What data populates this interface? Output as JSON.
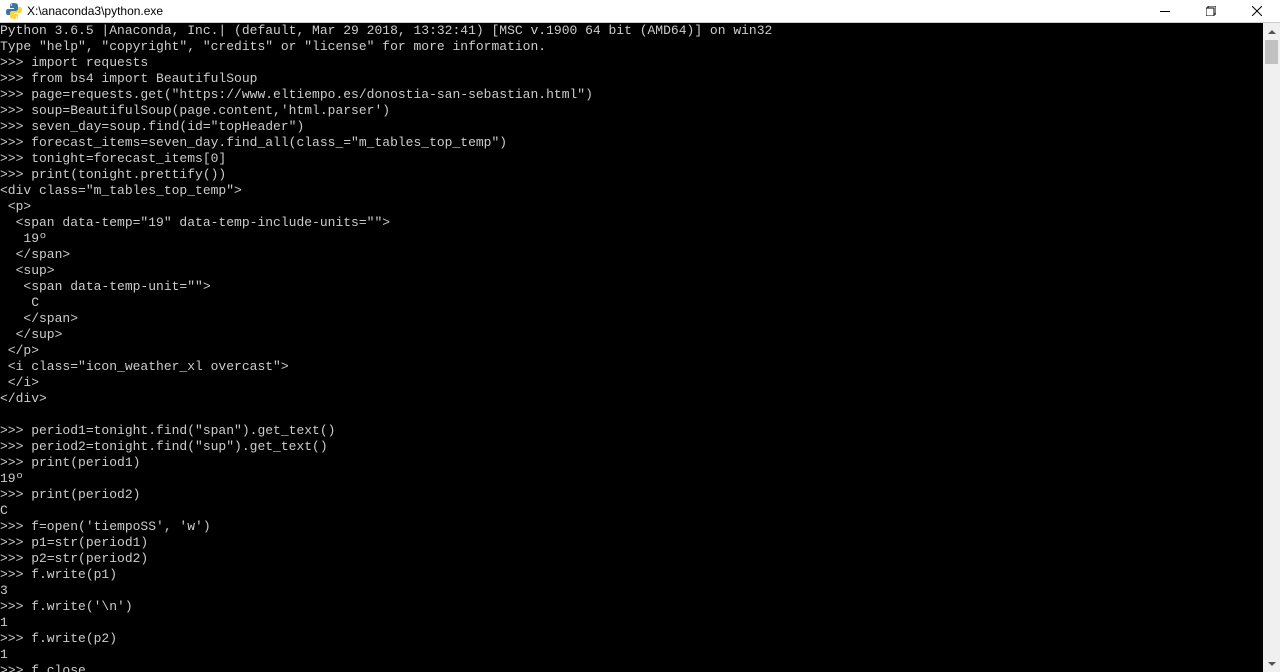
{
  "window": {
    "title": "X:\\anaconda3\\python.exe"
  },
  "terminal": {
    "lines": [
      "Python 3.6.5 |Anaconda, Inc.| (default, Mar 29 2018, 13:32:41) [MSC v.1900 64 bit (AMD64)] on win32",
      "Type \"help\", \"copyright\", \"credits\" or \"license\" for more information.",
      ">>> import requests",
      ">>> from bs4 import BeautifulSoup",
      ">>> page=requests.get(\"https://www.eltiempo.es/donostia-san-sebastian.html\")",
      ">>> soup=BeautifulSoup(page.content,'html.parser')",
      ">>> seven_day=soup.find(id=\"topHeader\")",
      ">>> forecast_items=seven_day.find_all(class_=\"m_tables_top_temp\")",
      ">>> tonight=forecast_items[0]",
      ">>> print(tonight.prettify())",
      "<div class=\"m_tables_top_temp\">",
      " <p>",
      "  <span data-temp=\"19\" data-temp-include-units=\"\">",
      "   19º",
      "  </span>",
      "  <sup>",
      "   <span data-temp-unit=\"\">",
      "    C",
      "   </span>",
      "  </sup>",
      " </p>",
      " <i class=\"icon_weather_xl overcast\">",
      " </i>",
      "</div>",
      "",
      ">>> period1=tonight.find(\"span\").get_text()",
      ">>> period2=tonight.find(\"sup\").get_text()",
      ">>> print(period1)",
      "19º",
      ">>> print(period2)",
      "C",
      ">>> f=open('tiempoSS', 'w')",
      ">>> p1=str(period1)",
      ">>> p2=str(period2)",
      ">>> f.write(p1)",
      "3",
      ">>> f.write('\\n')",
      "1",
      ">>> f.write(p2)",
      "1",
      ">>> f.close"
    ]
  }
}
